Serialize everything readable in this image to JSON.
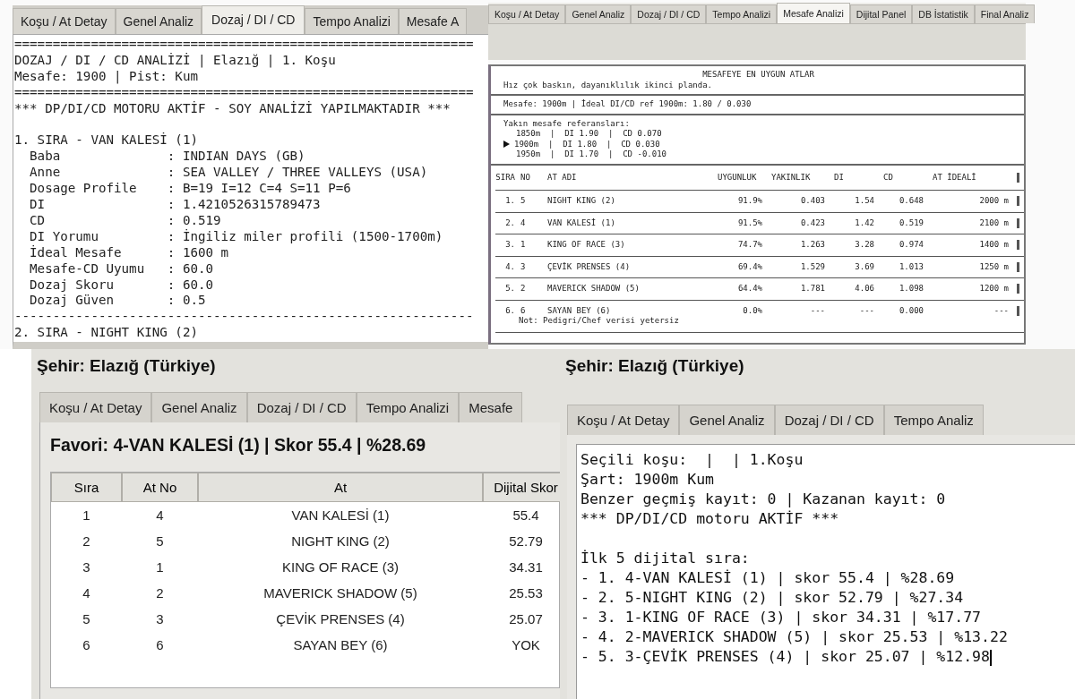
{
  "dosage_panel": {
    "tabs": [
      {
        "label": "Koşu / At Detay",
        "selected": false
      },
      {
        "label": "Genel Analiz",
        "selected": false
      },
      {
        "label": "Dozaj / DI / CD",
        "selected": true
      },
      {
        "label": "Tempo Analizi",
        "selected": false
      },
      {
        "label": "Mesafe A",
        "selected": false
      }
    ],
    "lines": [
      {
        "kind": "rule",
        "text": "============================================================"
      },
      {
        "kind": "text",
        "text": "DOZAJ / DI / CD ANALİZİ | Elazığ | 1. Koşu"
      },
      {
        "kind": "text",
        "text": "Mesafe: 1900 | Pist: Kum"
      },
      {
        "kind": "rule",
        "text": "============================================================"
      },
      {
        "kind": "text",
        "text": "*** DP/DI/CD MOTORU AKTİF - SOY ANALİZİ YAPILMAKTADIR ***"
      },
      {
        "kind": "gap"
      },
      {
        "kind": "text",
        "text": "1. SIRA - VAN KALESİ (1)"
      },
      {
        "kind": "text",
        "text": "  Baba              : INDIAN DAYS (GB)"
      },
      {
        "kind": "text",
        "text": "  Anne              : SEA VALLEY / THREE VALLEYS (USA)"
      },
      {
        "kind": "text",
        "text": "  Dosage Profile    : B=19 I=12 C=4 S=11 P=6"
      },
      {
        "kind": "text",
        "text": "  DI                : 1.4210526315789473"
      },
      {
        "kind": "text",
        "text": "  CD                : 0.519"
      },
      {
        "kind": "text",
        "text": "  DI Yorumu         : İngiliz miler profili (1500-1700m)"
      },
      {
        "kind": "text",
        "text": "  İdeal Mesafe      : 1600 m"
      },
      {
        "kind": "text",
        "text": "  Mesafe-CD Uyumu   : 60.0"
      },
      {
        "kind": "text",
        "text": "  Dozaj Skoru       : 60.0"
      },
      {
        "kind": "text",
        "text": "  Dozaj Güven       : 0.5"
      },
      {
        "kind": "rule",
        "text": "------------------------------------------------------------"
      },
      {
        "kind": "text",
        "text": "2. SIRA - NIGHT KING (2)"
      }
    ]
  },
  "distance_panel": {
    "tabs": [
      {
        "label": "Koşu / At Detay",
        "selected": false
      },
      {
        "label": "Genel Analiz",
        "selected": false
      },
      {
        "label": "Dozaj / DI / CD",
        "selected": false
      },
      {
        "label": "Tempo Analizi",
        "selected": false
      },
      {
        "label": "Mesafe Analizi",
        "selected": true
      },
      {
        "label": "Dijital Panel",
        "selected": false
      },
      {
        "label": "DB İstatistik",
        "selected": false
      },
      {
        "label": "Final Analiz",
        "selected": false
      }
    ],
    "title": "MESAFEYE EN UYGUN ATLAR",
    "note": "Hız çok baskın, dayanıklılık ikinci planda.",
    "distance_line": "Mesafe: 1900m | İdeal DI/CD ref 1900m: 1.80 / 0.030",
    "references": {
      "heading": "Yakın mesafe referansları:",
      "rows": [
        {
          "text": "1850m  |  DI 1.90  |  CD 0.070",
          "selected": false
        },
        {
          "text": "1900m  |  DI 1.80  |  CD 0.030",
          "selected": true
        },
        {
          "text": "1950m  |  DI 1.70  |  CD -0.010",
          "selected": false
        }
      ]
    },
    "table": {
      "columns": [
        "SIRA",
        "NO",
        "AT ADI",
        "UYGUNLUK",
        "YAKINLIK",
        "DI",
        "CD",
        "AT İDEALİ"
      ],
      "rows": [
        {
          "cells": [
            "1.",
            "5",
            "NIGHT KING (2)",
            "91.9%",
            "0.403",
            "1.54",
            "0.648",
            "2000 m"
          ]
        },
        {
          "cells": [
            "2.",
            "4",
            "VAN KALESİ (1)",
            "91.5%",
            "0.423",
            "1.42",
            "0.519",
            "2100 m"
          ]
        },
        {
          "cells": [
            "3.",
            "1",
            "KING OF RACE (3)",
            "74.7%",
            "1.263",
            "3.28",
            "0.974",
            "1400 m"
          ]
        },
        {
          "cells": [
            "4.",
            "3",
            "ÇEVİK PRENSES (4)",
            "69.4%",
            "1.529",
            "3.69",
            "1.013",
            "1250 m"
          ]
        },
        {
          "cells": [
            "5.",
            "2",
            "MAVERICK SHADOW (5)",
            "64.4%",
            "1.781",
            "4.06",
            "1.098",
            "1200 m"
          ]
        },
        {
          "cells": [
            "6.",
            "6",
            "SAYAN BEY (6)",
            "0.0%",
            "---",
            "---",
            "0.000",
            "---"
          ],
          "note": "Not: Pedigri/Chef verisi yetersiz"
        }
      ]
    }
  },
  "ranking_panel": {
    "city": "Şehir: Elazığ (Türkiye)",
    "tabs": [
      {
        "label": "Koşu / At Detay"
      },
      {
        "label": "Genel Analiz"
      },
      {
        "label": "Dozaj / DI / CD"
      },
      {
        "label": "Tempo Analizi"
      },
      {
        "label": "Mesafe"
      }
    ],
    "favorite": "Favori: 4-VAN KALESİ (1) | Skor 55.4 | %28.69",
    "table": {
      "columns": [
        "Sıra",
        "At No",
        "At",
        "Dijital Skor"
      ],
      "rows": [
        [
          "1",
          "4",
          "VAN KALESİ (1)",
          "55.4"
        ],
        [
          "2",
          "5",
          "NIGHT KING (2)",
          "52.79"
        ],
        [
          "3",
          "1",
          "KING OF RACE (3)",
          "34.31"
        ],
        [
          "4",
          "2",
          "MAVERICK SHADOW (5)",
          "25.53"
        ],
        [
          "5",
          "3",
          "ÇEVİK PRENSES (4)",
          "25.07"
        ],
        [
          "6",
          "6",
          "SAYAN BEY (6)",
          "YOK"
        ]
      ]
    }
  },
  "summary_panel": {
    "city": "Şehir: Elazığ (Türkiye)",
    "tabs": [
      {
        "label": "Koşu / At Detay"
      },
      {
        "label": "Genel Analiz"
      },
      {
        "label": "Dozaj / DI / CD"
      },
      {
        "label": "Tempo Analiz"
      }
    ],
    "lines": [
      {
        "kind": "text",
        "text": "Seçili koşu:  |  | 1.Koşu"
      },
      {
        "kind": "text",
        "text": "Şart: 1900m Kum"
      },
      {
        "kind": "text",
        "text": "Benzer geçmiş kayıt: 0 | Kazanan kayıt: 0"
      },
      {
        "kind": "text",
        "text": "*** DP/DI/CD motoru AKTİF ***"
      },
      {
        "kind": "gap"
      },
      {
        "kind": "text",
        "text": "İlk 5 dijital sıra:"
      },
      {
        "kind": "text",
        "text": "- 1. 4-VAN KALESİ (1) | skor 55.4 | %28.69"
      },
      {
        "kind": "text",
        "text": "- 2. 5-NIGHT KING (2) | skor 52.79 | %27.34"
      },
      {
        "kind": "text",
        "text": "- 3. 1-KING OF RACE (3) | skor 34.31 | %17.77"
      },
      {
        "kind": "text",
        "text": "- 4. 2-MAVERICK SHADOW (5) | skor 25.53 | %13.22"
      },
      {
        "kind": "text",
        "text": "- 5. 3-ÇEVİK PRENSES (4) | skor 25.07 | %12.98"
      }
    ]
  }
}
